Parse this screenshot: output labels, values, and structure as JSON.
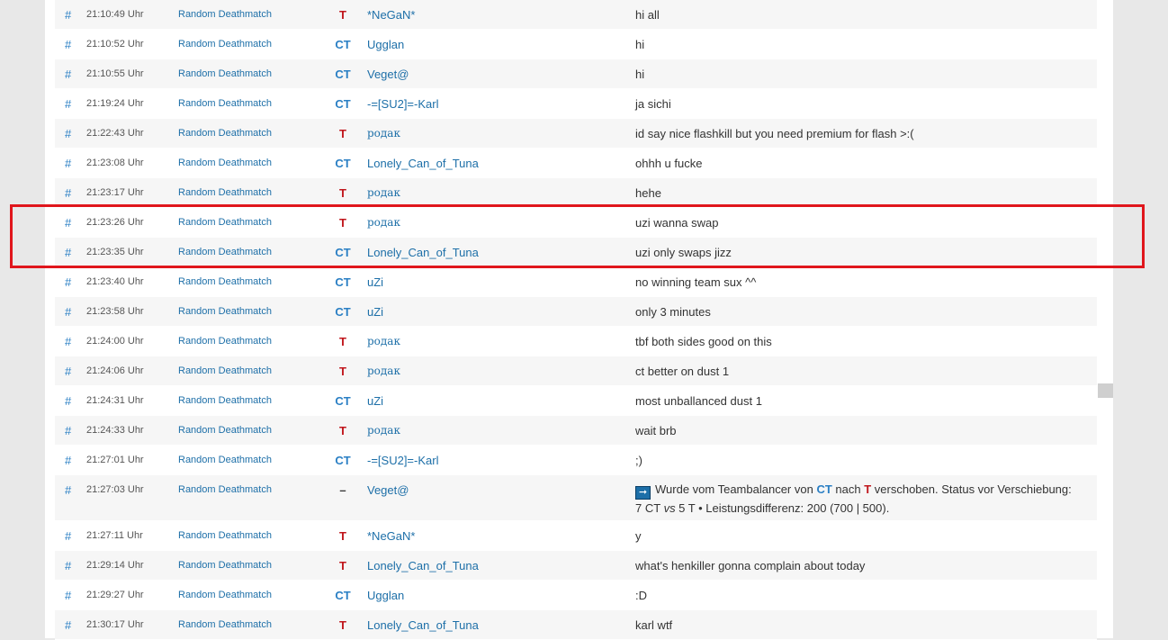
{
  "colors": {
    "ct": "#2a7fc4",
    "t": "#c0161c",
    "highlight": "#e0161c",
    "link": "#1d6fa8"
  },
  "highlighted_rows": [
    7,
    8
  ],
  "rows": [
    {
      "hash": "#",
      "time": "21:10:49 Uhr",
      "server": "Random Deathmatch",
      "team": "T",
      "player": "*NeGaN*",
      "message": "hi all"
    },
    {
      "hash": "#",
      "time": "21:10:52 Uhr",
      "server": "Random Deathmatch",
      "team": "CT",
      "player": "Ugglan",
      "message": "hi"
    },
    {
      "hash": "#",
      "time": "21:10:55 Uhr",
      "server": "Random Deathmatch",
      "team": "CT",
      "player": "Veget@",
      "message": "hi"
    },
    {
      "hash": "#",
      "time": "21:19:24 Uhr",
      "server": "Random Deathmatch",
      "team": "CT",
      "player": "-=[SU2]=-Karl",
      "message": "ja sichi"
    },
    {
      "hash": "#",
      "time": "21:22:43 Uhr",
      "server": "Random Deathmatch",
      "team": "T",
      "player": "родак",
      "message": "id say nice flashkill but you need premium for flash >:("
    },
    {
      "hash": "#",
      "time": "21:23:08 Uhr",
      "server": "Random Deathmatch",
      "team": "CT",
      "player": "Lonely_Can_of_Tuna",
      "message": "ohhh u fucke"
    },
    {
      "hash": "#",
      "time": "21:23:17 Uhr",
      "server": "Random Deathmatch",
      "team": "T",
      "player": "родак",
      "message": "hehe"
    },
    {
      "hash": "#",
      "time": "21:23:26 Uhr",
      "server": "Random Deathmatch",
      "team": "T",
      "player": "родак",
      "message": "uzi wanna swap"
    },
    {
      "hash": "#",
      "time": "21:23:35 Uhr",
      "server": "Random Deathmatch",
      "team": "CT",
      "player": "Lonely_Can_of_Tuna",
      "message": "uzi only swaps jizz"
    },
    {
      "hash": "#",
      "time": "21:23:40 Uhr",
      "server": "Random Deathmatch",
      "team": "CT",
      "player": "uZi",
      "message": "no winning team sux ^^"
    },
    {
      "hash": "#",
      "time": "21:23:58 Uhr",
      "server": "Random Deathmatch",
      "team": "CT",
      "player": "uZi",
      "message": "only 3 minutes"
    },
    {
      "hash": "#",
      "time": "21:24:00 Uhr",
      "server": "Random Deathmatch",
      "team": "T",
      "player": "родак",
      "message": "tbf both sides good on this"
    },
    {
      "hash": "#",
      "time": "21:24:06 Uhr",
      "server": "Random Deathmatch",
      "team": "T",
      "player": "родак",
      "message": "ct better on dust 1"
    },
    {
      "hash": "#",
      "time": "21:24:31 Uhr",
      "server": "Random Deathmatch",
      "team": "CT",
      "player": "uZi",
      "message": "most unballanced dust 1"
    },
    {
      "hash": "#",
      "time": "21:24:33 Uhr",
      "server": "Random Deathmatch",
      "team": "T",
      "player": "родак",
      "message": "wait brb"
    },
    {
      "hash": "#",
      "time": "21:27:01 Uhr",
      "server": "Random Deathmatch",
      "team": "CT",
      "player": "-=[SU2]=-Karl",
      "message": ";)"
    },
    {
      "hash": "#",
      "time": "21:27:03 Uhr",
      "server": "Random Deathmatch",
      "team": "–",
      "player": "Veget@",
      "system": true,
      "message_parts": {
        "icon": "arrow-right-icon",
        "p1": "Wurde vom Teambalancer von ",
        "ct": "CT",
        "p2": " nach ",
        "t": "T",
        "p3": " verschoben. Status vor Verschiebung:",
        "line2a": "7 CT ",
        "vs": "vs",
        "line2b": " 5 T • Leistungsdifferenz: 200 (700 | 500)."
      }
    },
    {
      "hash": "#",
      "time": "21:27:11 Uhr",
      "server": "Random Deathmatch",
      "team": "T",
      "player": "*NeGaN*",
      "message": "y"
    },
    {
      "hash": "#",
      "time": "21:29:14 Uhr",
      "server": "Random Deathmatch",
      "team": "T",
      "player": "Lonely_Can_of_Tuna",
      "message": "what's henkiller gonna complain about today"
    },
    {
      "hash": "#",
      "time": "21:29:27 Uhr",
      "server": "Random Deathmatch",
      "team": "CT",
      "player": "Ugglan",
      "message": ":D"
    },
    {
      "hash": "#",
      "time": "21:30:17 Uhr",
      "server": "Random Deathmatch",
      "team": "T",
      "player": "Lonely_Can_of_Tuna",
      "message": "karl wtf"
    }
  ]
}
